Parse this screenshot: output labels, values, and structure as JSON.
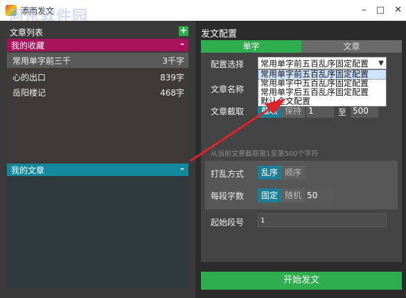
{
  "window": {
    "title": "添雨发文",
    "watermark": "河东软件园",
    "watermark_url": "www.pc0359.cn"
  },
  "left": {
    "list_header": "文章列表",
    "favorites": {
      "label": "我的收藏",
      "items": [
        {
          "name": "常用单字前三千",
          "count": "3千字"
        },
        {
          "name": "心的出口",
          "count": "839字"
        },
        {
          "name": "岳阳楼记",
          "count": "468字"
        }
      ]
    },
    "my_articles": {
      "label": "我的文章"
    }
  },
  "right": {
    "title": "发文配置",
    "tabs": [
      "单字",
      "文章"
    ],
    "config_label": "配置选择",
    "config_value": "常用单字前五百乱序固定配置",
    "dropdown_options": [
      "常用单字前五百乱序固定配置",
      "常用单字中五百乱序固定配置",
      "常用单字后五百乱序固定配置",
      "默认全文配置"
    ],
    "article_name_label": "文章名称",
    "article_cut_label": "文章截取",
    "cut_mode_on": "截取",
    "cut_mode_off": "保持",
    "cut_from": "1",
    "cut_to_label": "至",
    "cut_to": "500",
    "cut_hint": "从当前文章截取第1至第500个字符",
    "disrupt_label": "打乱方式",
    "disrupt_on": "乱序",
    "disrupt_off": "顺序",
    "per_segment_label": "每段字数",
    "seg_fixed": "固定",
    "seg_random": "随机",
    "seg_count": "50",
    "start_para_label": "起始段号",
    "start_para": "1",
    "start_button": "开始发文"
  },
  "colors": {
    "accent_green": "#2fae4f",
    "fav_magenta": "#a8125a",
    "my_teal": "#14899e",
    "arrow_red": "#e0242a"
  }
}
